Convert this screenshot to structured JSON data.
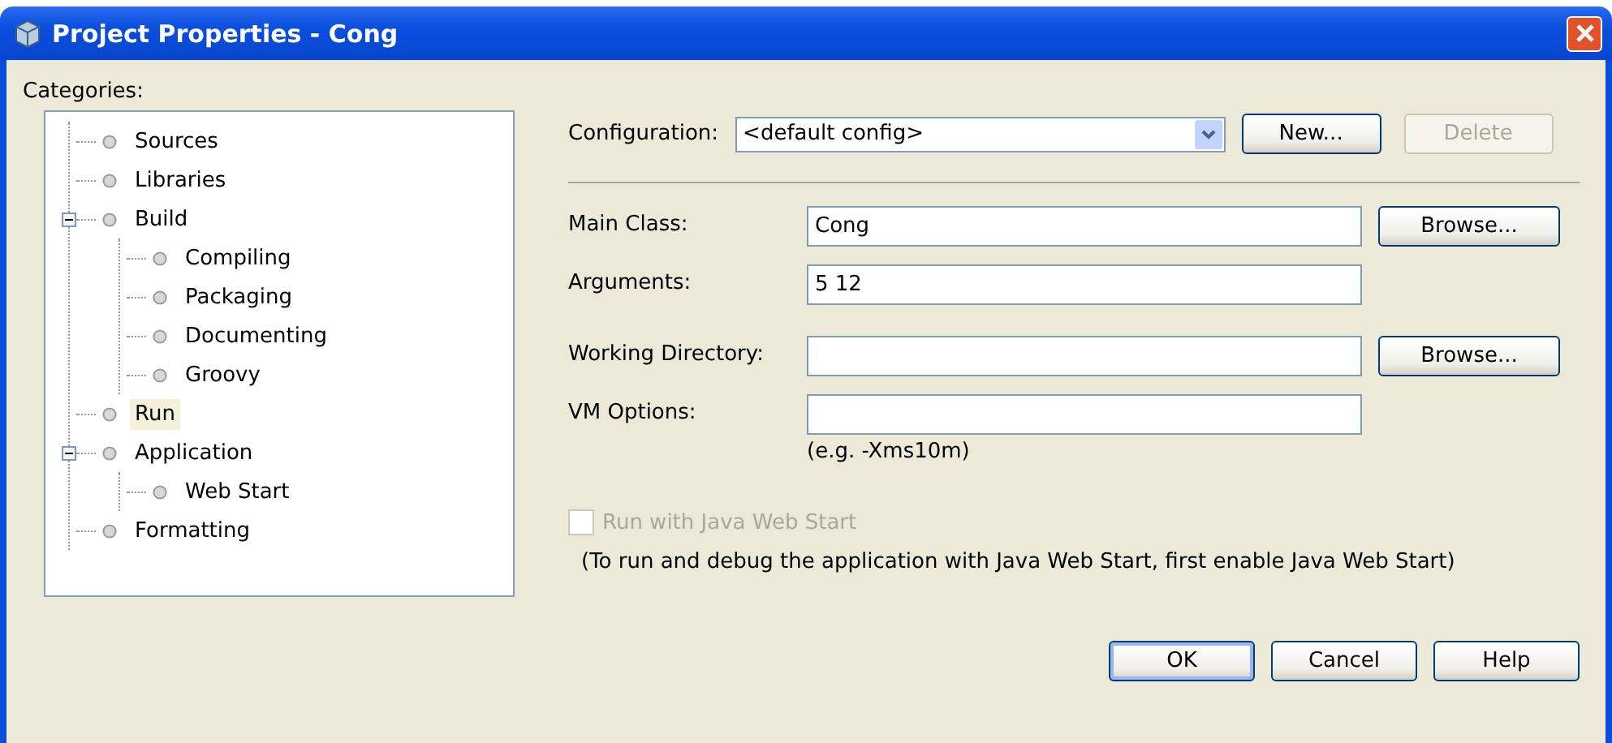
{
  "window": {
    "title": "Project Properties - Cong"
  },
  "categories": {
    "label": "Categories:",
    "items": [
      {
        "label": "Sources",
        "selected": false
      },
      {
        "label": "Libraries",
        "selected": false
      },
      {
        "label": "Build",
        "selected": false,
        "expanded": true,
        "children": [
          {
            "label": "Compiling",
            "selected": false
          },
          {
            "label": "Packaging",
            "selected": false
          },
          {
            "label": "Documenting",
            "selected": false
          },
          {
            "label": "Groovy",
            "selected": false
          }
        ]
      },
      {
        "label": "Run",
        "selected": true
      },
      {
        "label": "Application",
        "selected": false,
        "expanded": true,
        "children": [
          {
            "label": "Web Start",
            "selected": false
          }
        ]
      },
      {
        "label": "Formatting",
        "selected": false
      }
    ]
  },
  "configuration": {
    "label": "Configuration:",
    "value": "<default config>",
    "buttons": [
      {
        "label": "New...",
        "disabled": false
      },
      {
        "label": "Delete",
        "disabled": true
      }
    ]
  },
  "fields": [
    {
      "label": "Main Class:",
      "value": "Cong",
      "button": "Browse..."
    },
    {
      "label": "Arguments:",
      "value": "5 12"
    },
    {
      "label": "Working Directory:",
      "button": "Browse..."
    },
    {
      "label": "VM Options:",
      "hint": "(e.g. -Xms10m)"
    }
  ],
  "web_start": {
    "label": "Run with Java Web Start",
    "checked": false,
    "disabled": true,
    "note": "(To run and debug the application with Java Web Start, first enable Java Web Start)"
  },
  "buttons": [
    {
      "label": "OK",
      "default": true
    },
    {
      "label": "Cancel",
      "default": false
    },
    {
      "label": "Help",
      "default": false
    }
  ]
}
